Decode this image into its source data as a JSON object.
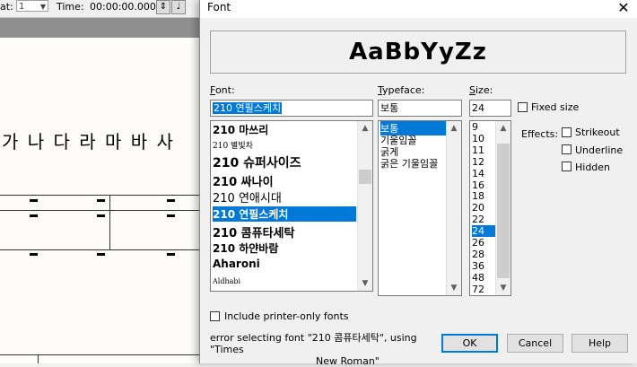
{
  "background": {
    "toolbar": {
      "beat_label": "at:",
      "beat_value": "1",
      "time_label": "Time:",
      "time_value": "00:00:00.000",
      "note_icon": "quarter-note-icon"
    },
    "lyrics": "가 나 다 라 마 바 사"
  },
  "dialog": {
    "title": "Font",
    "preview_text": "AaBbYyZz",
    "font_label": "Font:",
    "font_value": "210 연필스케치",
    "fonts": [
      {
        "label": "210 마쓰리"
      },
      {
        "label": "210 별빛차"
      },
      {
        "label": "210 슈퍼사이즈"
      },
      {
        "label": "210 싸나이"
      },
      {
        "label": "210 연애시대"
      },
      {
        "label": "210 연필스케치"
      },
      {
        "label": "210 콤퓨타세탁"
      },
      {
        "label": "210 하얀바람"
      },
      {
        "label": "Aharoni"
      },
      {
        "label": "Aldhabi"
      }
    ],
    "typeface_label": "Typeface:",
    "typeface_value": "보통",
    "typefaces": [
      {
        "label": "보통"
      },
      {
        "label": "기울임꼴"
      },
      {
        "label": "굵게"
      },
      {
        "label": "굵은 기울임꼴"
      }
    ],
    "size_label": "Size:",
    "size_value": "24",
    "sizes": [
      "9",
      "10",
      "11",
      "12",
      "14",
      "16",
      "18",
      "20",
      "22",
      "24",
      "26",
      "28",
      "36",
      "48",
      "72"
    ],
    "fixed_size_label": "Fixed size",
    "effects_label": "Effects:",
    "strikeout_label": "Strikeout",
    "underline_label": "Underline",
    "hidden_label": "Hidden",
    "include_printer_label": "Include printer-only fonts",
    "status_line1": "error selecting font \"210 콤퓨타세탁\", using \"Times",
    "status_line2": "New Roman\"",
    "ok_label": "OK",
    "cancel_label": "Cancel",
    "help_label": "Help",
    "accent_color": "#0078d7"
  }
}
